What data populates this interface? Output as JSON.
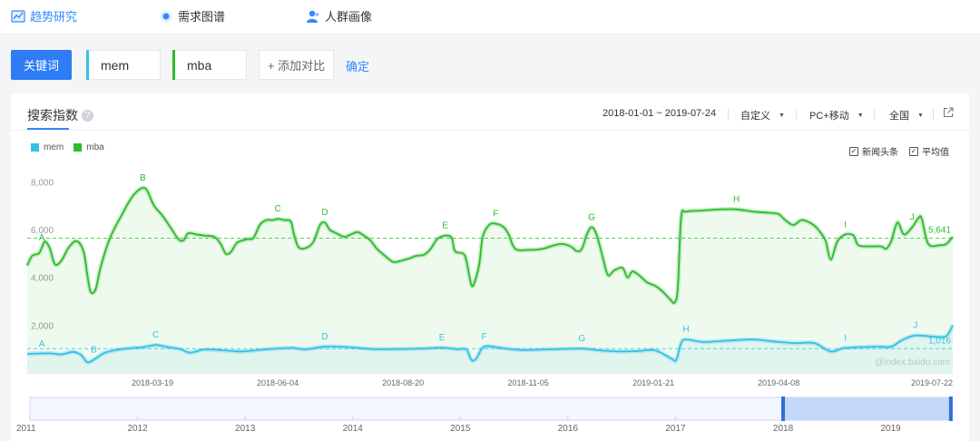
{
  "nav": {
    "tabs": [
      {
        "label": "趋势研究",
        "icon": "trend-chart-icon"
      },
      {
        "label": "需求图谱",
        "icon": "demand-graph-icon"
      },
      {
        "label": "人群画像",
        "icon": "crowd-portrait-icon"
      }
    ]
  },
  "controls": {
    "keyword_button": "关键词",
    "keywords": [
      {
        "value": "mem",
        "color": "#35c0e6"
      },
      {
        "value": "mba",
        "color": "#2dbb2d"
      }
    ],
    "add_compare": "+ 添加对比",
    "confirm": "确定"
  },
  "card": {
    "title": "搜索指数",
    "help_icon": "question-icon",
    "date_range": "2018-01-01 ~ 2019-07-24",
    "custom": "自定义",
    "device": "PC+移动",
    "region": "全国",
    "export_icon": "external-link-icon",
    "legend": [
      {
        "name": "mem",
        "color": "#35c0e6"
      },
      {
        "name": "mba",
        "color": "#2dbb2d"
      }
    ],
    "checkboxes": [
      {
        "label": "新闻头条",
        "checked": true
      },
      {
        "label": "平均值",
        "checked": true
      }
    ],
    "watermark": "@index.baidu.com"
  },
  "chart_data": {
    "type": "line",
    "y_ticks": [
      "8,000",
      "6,000",
      "4,000",
      "2,000"
    ],
    "ylim": [
      0,
      8700
    ],
    "x_tick_labels": [
      "2018-03-19",
      "2018-06-04",
      "2018-08-20",
      "2018-11-05",
      "2019-01-21",
      "2019-04-08",
      "2019-07-22"
    ],
    "x_range": [
      "2018-01-01",
      "2019-07-24"
    ],
    "grid": false,
    "legend_position": "top-left",
    "series": [
      {
        "name": "mba",
        "color": "#2dbb2d",
        "average": 5641,
        "average_label": "5,641",
        "points": [
          [
            "2018-01-01",
            4500
          ],
          [
            "2018-01-04",
            4900
          ],
          [
            "2018-01-08",
            5000
          ],
          [
            "2018-01-10",
            5250
          ],
          [
            "2018-01-12",
            5500
          ],
          [
            "2018-01-15",
            5200
          ],
          [
            "2018-01-18",
            4550
          ],
          [
            "2018-01-22",
            4700
          ],
          [
            "2018-01-26",
            5200
          ],
          [
            "2018-01-30",
            5500
          ],
          [
            "2018-02-02",
            5450
          ],
          [
            "2018-02-05",
            5000
          ],
          [
            "2018-02-07",
            4100
          ],
          [
            "2018-02-09",
            3400
          ],
          [
            "2018-02-12",
            3500
          ],
          [
            "2018-02-15",
            4400
          ],
          [
            "2018-02-20",
            5500
          ],
          [
            "2018-02-24",
            6100
          ],
          [
            "2018-02-28",
            6600
          ],
          [
            "2018-03-04",
            7100
          ],
          [
            "2018-03-08",
            7500
          ],
          [
            "2018-03-13",
            7750
          ],
          [
            "2018-03-16",
            7600
          ],
          [
            "2018-03-20",
            7000
          ],
          [
            "2018-03-25",
            6600
          ],
          [
            "2018-03-30",
            6100
          ],
          [
            "2018-04-04",
            5600
          ],
          [
            "2018-04-07",
            5550
          ],
          [
            "2018-04-10",
            5850
          ],
          [
            "2018-04-15",
            5800
          ],
          [
            "2018-04-20",
            5750
          ],
          [
            "2018-04-26",
            5700
          ],
          [
            "2018-04-30",
            5400
          ],
          [
            "2018-05-03",
            5000
          ],
          [
            "2018-05-06",
            5050
          ],
          [
            "2018-05-10",
            5450
          ],
          [
            "2018-05-16",
            5600
          ],
          [
            "2018-05-20",
            5650
          ],
          [
            "2018-05-24",
            6200
          ],
          [
            "2018-05-28",
            6400
          ],
          [
            "2018-06-01",
            6400
          ],
          [
            "2018-06-04",
            6450
          ],
          [
            "2018-06-08",
            6400
          ],
          [
            "2018-06-12",
            6350
          ],
          [
            "2018-06-14",
            5800
          ],
          [
            "2018-06-17",
            5250
          ],
          [
            "2018-06-22",
            5250
          ],
          [
            "2018-06-26",
            5500
          ],
          [
            "2018-06-30",
            6200
          ],
          [
            "2018-07-03",
            6300
          ],
          [
            "2018-07-06",
            6000
          ],
          [
            "2018-07-10",
            5850
          ],
          [
            "2018-07-15",
            5700
          ],
          [
            "2018-07-19",
            5800
          ],
          [
            "2018-07-23",
            5900
          ],
          [
            "2018-07-27",
            5750
          ],
          [
            "2018-07-31",
            5550
          ],
          [
            "2018-08-04",
            5200
          ],
          [
            "2018-08-09",
            4900
          ],
          [
            "2018-08-14",
            4650
          ],
          [
            "2018-08-19",
            4700
          ],
          [
            "2018-08-24",
            4800
          ],
          [
            "2018-08-28",
            4900
          ],
          [
            "2018-09-02",
            4950
          ],
          [
            "2018-09-06",
            5200
          ],
          [
            "2018-09-10",
            5600
          ],
          [
            "2018-09-15",
            5750
          ],
          [
            "2018-09-19",
            5650
          ],
          [
            "2018-09-21",
            5100
          ],
          [
            "2018-09-26",
            5000
          ],
          [
            "2018-09-28",
            4700
          ],
          [
            "2018-10-01",
            3700
          ],
          [
            "2018-10-03",
            3800
          ],
          [
            "2018-10-06",
            4600
          ],
          [
            "2018-10-08",
            5700
          ],
          [
            "2018-10-12",
            6200
          ],
          [
            "2018-10-16",
            6250
          ],
          [
            "2018-10-21",
            6100
          ],
          [
            "2018-10-24",
            5800
          ],
          [
            "2018-10-28",
            5200
          ],
          [
            "2018-11-05",
            5150
          ],
          [
            "2018-11-14",
            5200
          ],
          [
            "2018-11-21",
            5350
          ],
          [
            "2018-11-26",
            5400
          ],
          [
            "2018-12-01",
            5300
          ],
          [
            "2018-12-05",
            5100
          ],
          [
            "2018-12-08",
            5200
          ],
          [
            "2018-12-11",
            5800
          ],
          [
            "2018-12-14",
            6100
          ],
          [
            "2018-12-17",
            5800
          ],
          [
            "2018-12-21",
            4800
          ],
          [
            "2018-12-24",
            4100
          ],
          [
            "2018-12-28",
            4300
          ],
          [
            "2019-01-02",
            4400
          ],
          [
            "2019-01-05",
            4000
          ],
          [
            "2019-01-08",
            4250
          ],
          [
            "2019-01-12",
            4100
          ],
          [
            "2019-01-17",
            3800
          ],
          [
            "2019-01-22",
            3650
          ],
          [
            "2019-01-26",
            3450
          ],
          [
            "2019-01-31",
            3100
          ],
          [
            "2019-02-03",
            2950
          ],
          [
            "2019-02-05",
            3600
          ],
          [
            "2019-02-07",
            6500
          ],
          [
            "2019-02-10",
            6750
          ],
          [
            "2019-02-20",
            6800
          ],
          [
            "2019-03-03",
            6850
          ],
          [
            "2019-03-13",
            6850
          ],
          [
            "2019-03-24",
            6750
          ],
          [
            "2019-04-03",
            6700
          ],
          [
            "2019-04-08",
            6650
          ],
          [
            "2019-04-12",
            6400
          ],
          [
            "2019-04-17",
            6200
          ],
          [
            "2019-04-22",
            6400
          ],
          [
            "2019-04-27",
            6300
          ],
          [
            "2019-05-01",
            6100
          ],
          [
            "2019-05-04",
            5850
          ],
          [
            "2019-05-07",
            5500
          ],
          [
            "2019-05-10",
            4750
          ],
          [
            "2019-05-14",
            5500
          ],
          [
            "2019-05-19",
            5800
          ],
          [
            "2019-05-24",
            5750
          ],
          [
            "2019-05-27",
            5350
          ],
          [
            "2019-06-03",
            5300
          ],
          [
            "2019-06-10",
            5300
          ],
          [
            "2019-06-13",
            5200
          ],
          [
            "2019-06-16",
            5500
          ],
          [
            "2019-06-20",
            6300
          ],
          [
            "2019-06-24",
            5800
          ],
          [
            "2019-06-29",
            6100
          ],
          [
            "2019-07-03",
            6500
          ],
          [
            "2019-07-05",
            6450
          ],
          [
            "2019-07-09",
            5400
          ],
          [
            "2019-07-16",
            5350
          ],
          [
            "2019-07-20",
            5400
          ],
          [
            "2019-07-24",
            5700
          ]
        ],
        "annotations": [
          [
            "A",
            "2018-01-10",
            5250
          ],
          [
            "B",
            "2018-03-13",
            7750
          ],
          [
            "C",
            "2018-06-04",
            6450
          ],
          [
            "D",
            "2018-07-03",
            6300
          ],
          [
            "E",
            "2018-09-15",
            5750
          ],
          [
            "F",
            "2018-10-16",
            6250
          ],
          [
            "G",
            "2018-12-14",
            6100
          ],
          [
            "H",
            "2019-03-13",
            6850
          ],
          [
            "I",
            "2019-05-19",
            5800
          ],
          [
            "J",
            "2019-06-29",
            6100
          ]
        ]
      },
      {
        "name": "mem",
        "color": "#35c0e6",
        "average": 1016,
        "average_label": "1,016",
        "points": [
          [
            "2018-01-01",
            800
          ],
          [
            "2018-01-15",
            820
          ],
          [
            "2018-01-22",
            780
          ],
          [
            "2018-01-29",
            880
          ],
          [
            "2018-02-03",
            760
          ],
          [
            "2018-02-07",
            450
          ],
          [
            "2018-02-11",
            560
          ],
          [
            "2018-02-18",
            850
          ],
          [
            "2018-02-28",
            1000
          ],
          [
            "2018-03-13",
            1080
          ],
          [
            "2018-03-21",
            1170
          ],
          [
            "2018-03-28",
            1090
          ],
          [
            "2018-04-05",
            1000
          ],
          [
            "2018-04-11",
            850
          ],
          [
            "2018-04-20",
            980
          ],
          [
            "2018-05-01",
            950
          ],
          [
            "2018-05-12",
            900
          ],
          [
            "2018-05-20",
            940
          ],
          [
            "2018-06-01",
            1010
          ],
          [
            "2018-06-13",
            1050
          ],
          [
            "2018-06-21",
            990
          ],
          [
            "2018-07-03",
            1100
          ],
          [
            "2018-07-18",
            1080
          ],
          [
            "2018-08-01",
            1000
          ],
          [
            "2018-08-15",
            1000
          ],
          [
            "2018-08-31",
            1020
          ],
          [
            "2018-09-13",
            1060
          ],
          [
            "2018-09-22",
            1000
          ],
          [
            "2018-09-28",
            980
          ],
          [
            "2018-10-01",
            550
          ],
          [
            "2018-10-04",
            600
          ],
          [
            "2018-10-09",
            1100
          ],
          [
            "2018-10-19",
            1050
          ],
          [
            "2018-11-01",
            960
          ],
          [
            "2018-11-19",
            990
          ],
          [
            "2018-12-08",
            1020
          ],
          [
            "2018-12-18",
            950
          ],
          [
            "2018-12-31",
            900
          ],
          [
            "2019-01-12",
            920
          ],
          [
            "2019-01-22",
            950
          ],
          [
            "2019-02-01",
            600
          ],
          [
            "2019-02-04",
            550
          ],
          [
            "2019-02-07",
            1250
          ],
          [
            "2019-02-10",
            1400
          ],
          [
            "2019-02-21",
            1300
          ],
          [
            "2019-03-07",
            1350
          ],
          [
            "2019-03-23",
            1400
          ],
          [
            "2019-04-08",
            1300
          ],
          [
            "2019-04-19",
            1250
          ],
          [
            "2019-04-30",
            1250
          ],
          [
            "2019-05-10",
            900
          ],
          [
            "2019-05-19",
            1050
          ],
          [
            "2019-06-07",
            1100
          ],
          [
            "2019-06-16",
            1100
          ],
          [
            "2019-06-23",
            1380
          ],
          [
            "2019-07-01",
            1570
          ],
          [
            "2019-07-13",
            1520
          ],
          [
            "2019-07-20",
            1540
          ],
          [
            "2019-07-24",
            2000
          ]
        ],
        "annotations": [
          [
            "A",
            "2018-01-10",
            800
          ],
          [
            "B",
            "2018-02-11",
            560
          ],
          [
            "C",
            "2018-03-21",
            1170
          ],
          [
            "D",
            "2018-07-03",
            1100
          ],
          [
            "E",
            "2018-09-13",
            1060
          ],
          [
            "F",
            "2018-10-09",
            1100
          ],
          [
            "G",
            "2018-12-08",
            1020
          ],
          [
            "H",
            "2019-02-10",
            1400
          ],
          [
            "I",
            "2019-05-19",
            1050
          ],
          [
            "J",
            "2019-07-01",
            1570
          ]
        ]
      }
    ]
  },
  "timeline": {
    "years": [
      "2011",
      "2012",
      "2013",
      "2014",
      "2015",
      "2016",
      "2017",
      "2018",
      "2019"
    ],
    "range_start": 2011.0,
    "range_end": 2019.56,
    "selected": [
      "2018-01-01",
      "2019-07-24"
    ]
  }
}
